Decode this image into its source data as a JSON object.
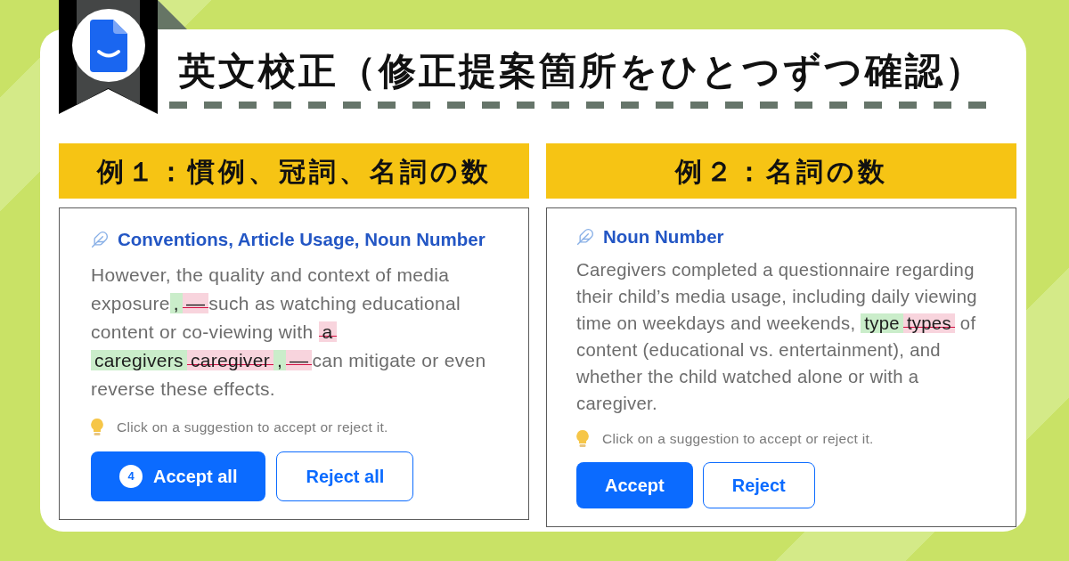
{
  "title": "英文校正（修正提案箇所をひとつずつ確認）",
  "examples": [
    {
      "heading": "例１：慣例、冠詞、名詞の数",
      "category": "Conventions, Article Usage, Noun Number",
      "segments": [
        {
          "kind": "text",
          "text": "However, the quality and context of media exposure"
        },
        {
          "kind": "edit",
          "parts": [
            {
              "kind": "insert",
              "text": ","
            },
            {
              "kind": "delete",
              "text": "—"
            }
          ]
        },
        {
          "kind": "text",
          "text": "such as watching educational content or co-viewing with "
        },
        {
          "kind": "edit",
          "parts": [
            {
              "kind": "delete",
              "text": "a"
            }
          ]
        },
        {
          "kind": "edit",
          "parts": [
            {
              "kind": "insert",
              "text": "caregivers"
            },
            {
              "kind": "delete",
              "text": "caregiver"
            },
            {
              "kind": "insert",
              "text": ","
            },
            {
              "kind": "delete",
              "text": "—"
            }
          ]
        },
        {
          "kind": "text",
          "text": "can mitigate or even reverse these effects."
        }
      ],
      "hint": "Click on a suggestion to accept or reject it.",
      "buttons": [
        {
          "kind": "primary",
          "label": "Accept all",
          "count": "4"
        },
        {
          "kind": "secondary",
          "label": "Reject all"
        }
      ]
    },
    {
      "heading": "例２：名詞の数",
      "category": "Noun Number",
      "segments": [
        {
          "kind": "text",
          "text": "Caregivers completed a questionnaire regarding their child’s media usage, including daily viewing time on weekdays and weekends, "
        },
        {
          "kind": "edit",
          "parts": [
            {
              "kind": "insert",
              "text": "type"
            },
            {
              "kind": "delete",
              "text": "types"
            }
          ]
        },
        {
          "kind": "text",
          "text": " of content (educational vs. entertainment), and whether the child watched alone or with a caregiver."
        }
      ],
      "hint": "Click on a suggestion to accept or reject it.",
      "buttons": [
        {
          "kind": "primary",
          "label": "Accept"
        },
        {
          "kind": "secondary",
          "label": "Reject"
        }
      ]
    }
  ]
}
